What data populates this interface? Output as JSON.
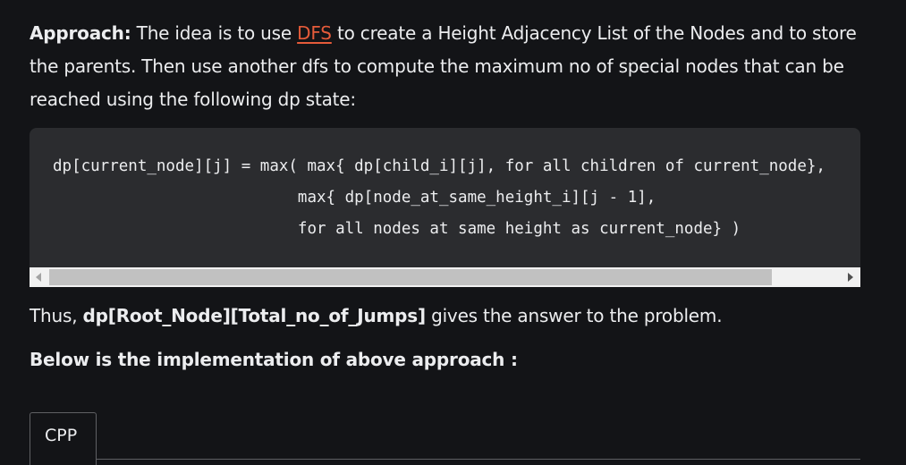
{
  "approach": {
    "label": "Approach:",
    "text_before_link": " The idea is to use ",
    "link_text": "DFS",
    "text_after_link": " to create a Height Adjacency List of the Nodes and to store the parents. Then use another dfs to compute the maximum no of special nodes that can be reached using the following dp state:"
  },
  "code": {
    "lines": [
      "dp[current_node][j] = max( max{ dp[child_i][j], for all children of current_node},",
      "                          max{ dp[node_at_same_height_i][j - 1],",
      "                          for all nodes at same height as current_node} )"
    ]
  },
  "conclusion": {
    "prefix": "Thus, ",
    "bold": "dp[Root_Node][Total_no_of_Jumps]",
    "suffix": " gives the answer to the problem."
  },
  "implementation_heading": "Below is the implementation of above approach :",
  "tabs": [
    {
      "label": "CPP"
    }
  ],
  "colors": {
    "background": "#131417",
    "text": "#ecedef",
    "link": "#e55b3a",
    "code_background": "#2b2c2f"
  }
}
